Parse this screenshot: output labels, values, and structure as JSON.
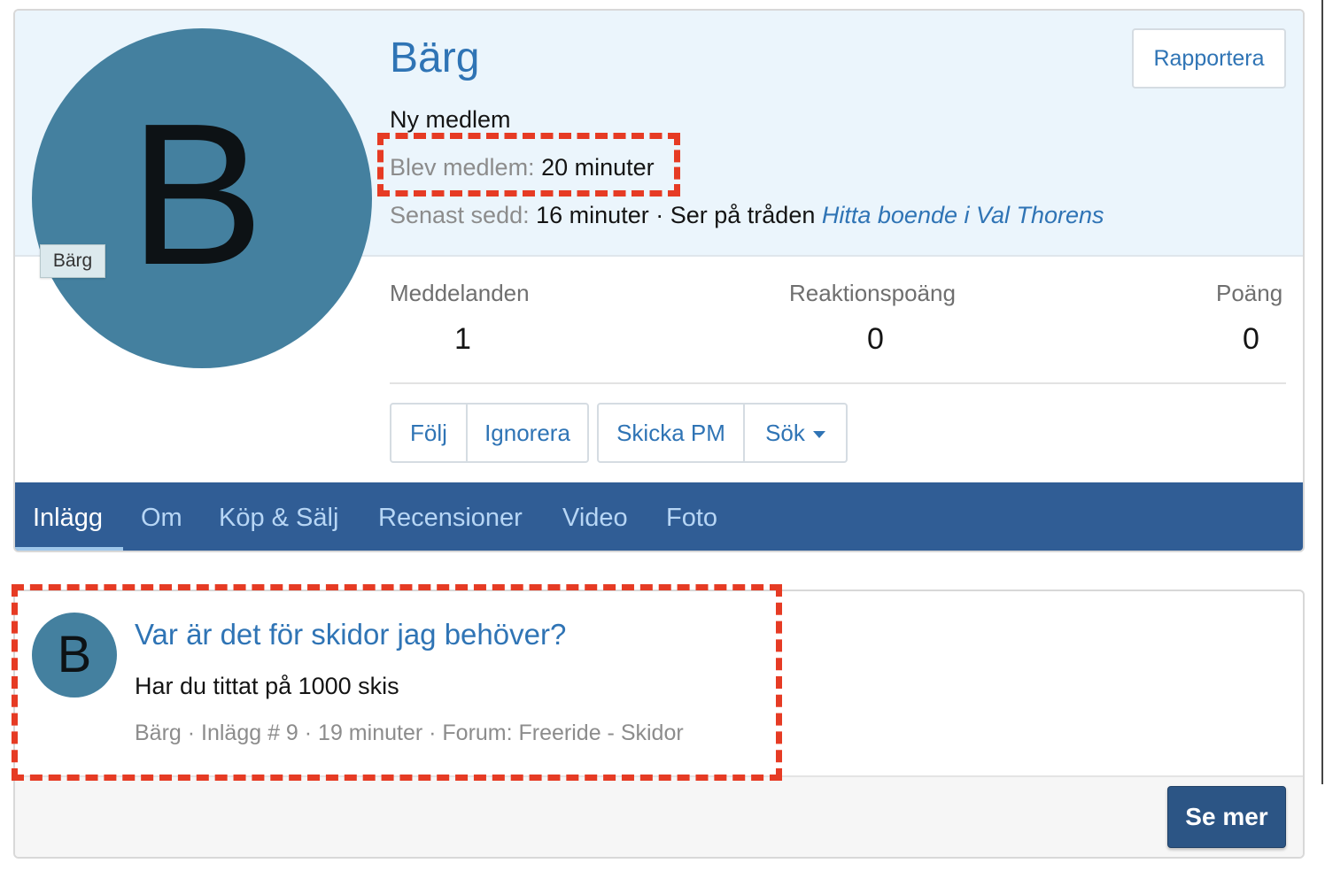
{
  "profile": {
    "avatar_letter": "B",
    "avatar_tooltip": "Bärg",
    "username": "Bärg",
    "report_label": "Rapportera",
    "user_title": "Ny medlem",
    "joined_label": "Blev medlem:",
    "joined_value": "20 minuter",
    "lastseen_label": "Senast sedd:",
    "lastseen_value": "16 minuter",
    "activity_separator": "·",
    "activity_text": "Ser på tråden",
    "activity_thread": "Hitta boende i Val Thorens"
  },
  "stats": [
    {
      "label": "Meddelanden",
      "value": "1"
    },
    {
      "label": "Reaktionspoäng",
      "value": "0"
    },
    {
      "label": "Poäng",
      "value": "0"
    }
  ],
  "actions": {
    "follow": "Följ",
    "ignore": "Ignorera",
    "send_pm": "Skicka PM",
    "search": "Sök"
  },
  "tabs": [
    {
      "label": "Inlägg",
      "active": true
    },
    {
      "label": "Om",
      "active": false
    },
    {
      "label": "Köp & Sälj",
      "active": false
    },
    {
      "label": "Recensioner",
      "active": false
    },
    {
      "label": "Video",
      "active": false
    },
    {
      "label": "Foto",
      "active": false
    }
  ],
  "post": {
    "avatar_letter": "B",
    "title": "Var är det för skidor jag behöver?",
    "snippet": "Har du tittat på 1000 skis",
    "meta": "Bärg · Inlägg # 9 · 19 minuter · Forum: Freeride - Skidor"
  },
  "see_more_label": "Se mer",
  "colors": {
    "link": "#2f74b5",
    "tab_bar": "#305d95",
    "header_bg": "#ebf5fc",
    "avatar_bg": "#44809f",
    "annotation": "#e63b24",
    "primary_button": "#2c5585"
  }
}
